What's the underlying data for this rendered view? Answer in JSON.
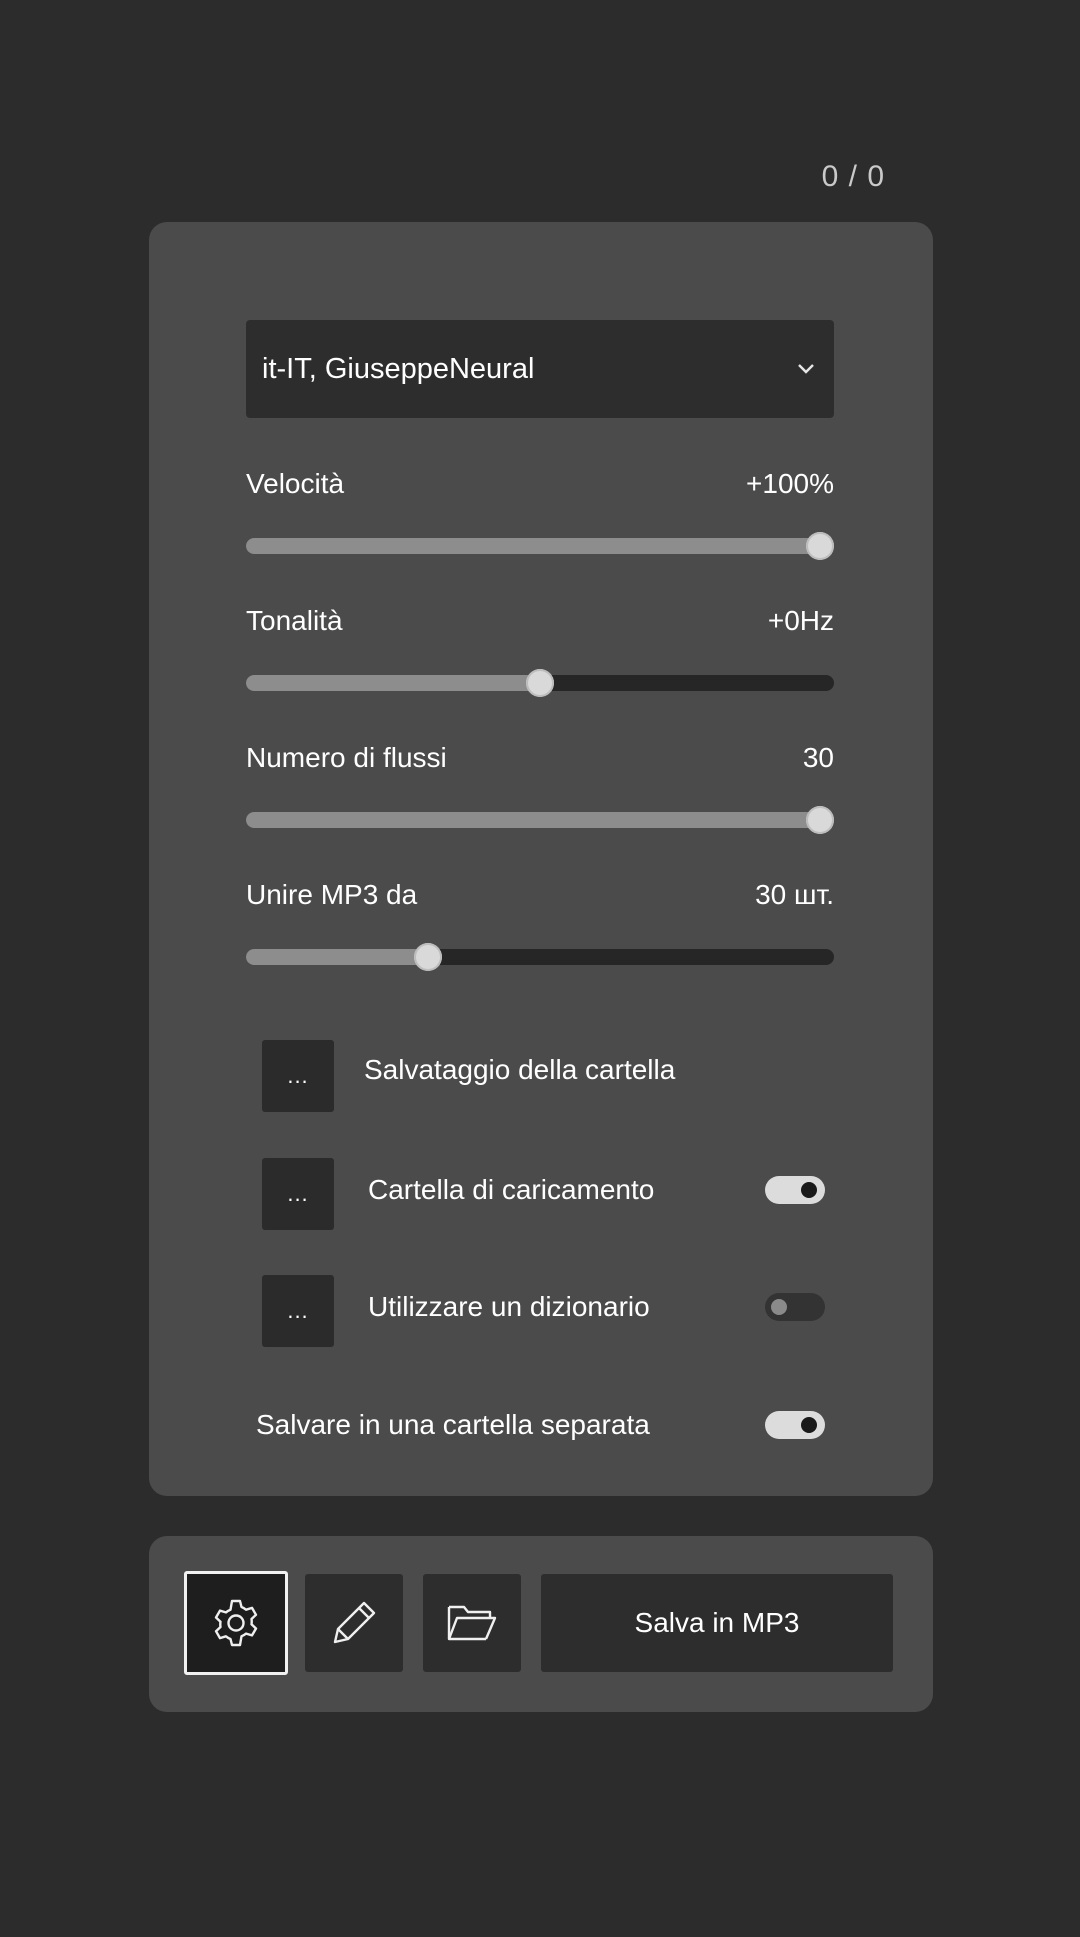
{
  "counter": "0 / 0",
  "voice": {
    "selected": "it-IT, GiuseppeNeural",
    "chevron_icon": "chevron-down-icon"
  },
  "sliders": {
    "speed": {
      "label": "Velocità",
      "value": "+100%",
      "level": 1.0
    },
    "pitch": {
      "label": "Tonalità",
      "value": "+0Hz",
      "level": 0.5
    },
    "threads": {
      "label": "Numero di flussi",
      "value": "30",
      "level": 1.0
    },
    "merge": {
      "label": "Unire MP3 da",
      "value": "30 шт.",
      "level": 0.3
    }
  },
  "options": {
    "save_folder": {
      "button": "...",
      "label": "Salvataggio della cartella"
    },
    "load_folder": {
      "button": "...",
      "label": "Cartella di caricamento",
      "enabled": true
    },
    "dictionary": {
      "button": "...",
      "label": "Utilizzare un dizionario",
      "enabled": false
    },
    "separate_folder": {
      "label": "Salvare in una cartella separata",
      "enabled": true
    }
  },
  "toolbar": {
    "settings_icon": "gear-icon",
    "edit_icon": "pencil-icon",
    "folder_icon": "folder-open-icon",
    "save_label": "Salva in MP3"
  }
}
